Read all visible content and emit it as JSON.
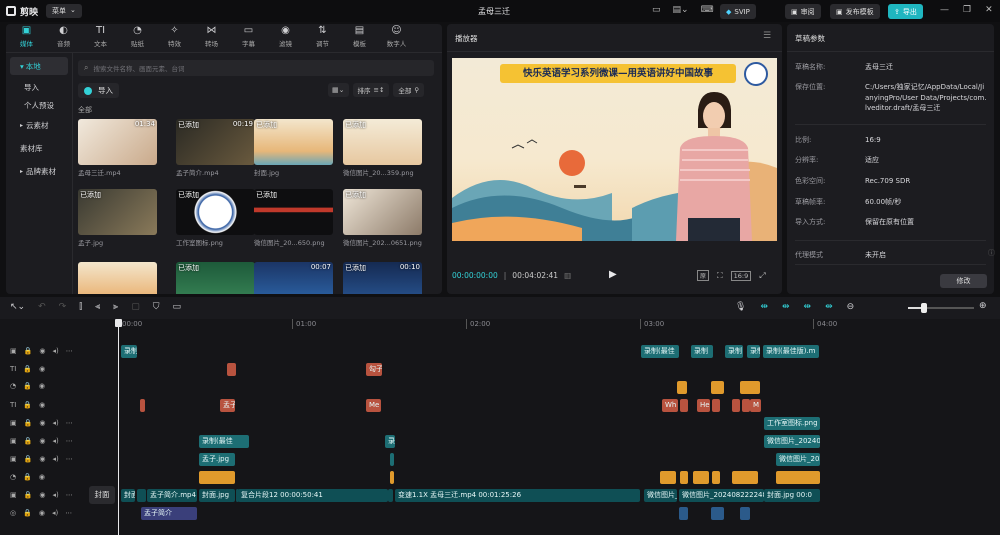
{
  "titlebar": {
    "app_name": "剪映",
    "menu_label": "菜单",
    "project_title": "孟母三迁",
    "svip_label": "SVIP",
    "review_label": "审阅",
    "publish_template_label": "发布模板",
    "export_label": "导出"
  },
  "media_tabs": [
    {
      "label": "媒体",
      "icon": "▣"
    },
    {
      "label": "音频",
      "icon": "◐"
    },
    {
      "label": "文本",
      "icon": "TI"
    },
    {
      "label": "贴纸",
      "icon": "◔"
    },
    {
      "label": "特效",
      "icon": "✧"
    },
    {
      "label": "转场",
      "icon": "⋈"
    },
    {
      "label": "字幕",
      "icon": "▭"
    },
    {
      "label": "滤镜",
      "icon": "◉"
    },
    {
      "label": "调节",
      "icon": "⇅"
    },
    {
      "label": "模板",
      "icon": "▤"
    },
    {
      "label": "数字人",
      "icon": "☺"
    }
  ],
  "sidebar": {
    "local": "本地",
    "import": "导入",
    "personal_preset": "个人预设",
    "cloud": "云素材",
    "library": "素材库",
    "brand": "品牌素材"
  },
  "media": {
    "search_placeholder": "搜索文件名称、画面元素、台词",
    "import_label": "导入",
    "sort_label": "排序",
    "all_label": "全部",
    "section_label": "全部",
    "items": [
      {
        "label": "孟母三迁.mp4",
        "badge": "",
        "duration": "01:34"
      },
      {
        "label": "孟子简介.mp4",
        "badge": "已添加",
        "duration": "00:19"
      },
      {
        "label": "封面.jpg",
        "badge": "已添加",
        "duration": ""
      },
      {
        "label": "微信图片_20...359.png",
        "badge": "已添加",
        "duration": ""
      },
      {
        "label": "孟子.jpg",
        "badge": "已添加",
        "duration": ""
      },
      {
        "label": "工作室图标.png",
        "badge": "已添加",
        "duration": ""
      },
      {
        "label": "微信图片_20...650.png",
        "badge": "已添加",
        "duration": ""
      },
      {
        "label": "微信图片_202...0651.png",
        "badge": "已添加",
        "duration": ""
      },
      {
        "label": "",
        "badge": "",
        "duration": ""
      },
      {
        "label": "",
        "badge": "已添加",
        "duration": ""
      },
      {
        "label": "",
        "badge": "",
        "duration": "00:07"
      },
      {
        "label": "",
        "badge": "已添加",
        "duration": "00:10"
      }
    ]
  },
  "player": {
    "title": "播放器",
    "banner": "快乐英语学习系列微课—用英语讲好中国故事",
    "current_time": "00:00:00:00",
    "total_time": "00:04:02:41",
    "ratio_label": "16:9"
  },
  "draft": {
    "title": "草稿参数",
    "rows": [
      {
        "key": "草稿名称:",
        "value": "孟母三迁"
      },
      {
        "key": "保存位置:",
        "value": "C:/Users/独家记忆/AppData/Local/JianyingPro/User Data/Projects/com.lveditor.draft/孟母三迁"
      },
      {
        "key": "比例:",
        "value": "16:9"
      },
      {
        "key": "分辨率:",
        "value": "适应"
      },
      {
        "key": "色彩空间:",
        "value": "Rec.709 SDR"
      },
      {
        "key": "草稿帧率:",
        "value": "60.00帧/秒"
      },
      {
        "key": "导入方式:",
        "value": "保留在原有位置"
      },
      {
        "key": "代理模式",
        "value": "未开启"
      }
    ],
    "modify_label": "修改"
  },
  "timeline": {
    "cover_label": "封面",
    "ticks": [
      "00:00",
      "01:00",
      "02:00",
      "03:00",
      "04:00"
    ],
    "clips": {
      "t1a": "录制(最",
      "t1b": "录制(最佳",
      "t1c": "录制",
      "t1d": "录制",
      "t1e": "录制",
      "t1f": "录制(最佳版).m",
      "t3a": "勾子",
      "t5a": "孟子",
      "t5b": "Me",
      "t5c": "Wh",
      "t5d": "He",
      "t5e": "M",
      "t6a": "工作室图标.png",
      "t7a": "录制(最佳",
      "t7b": "录",
      "t7c": "微信图片_202408",
      "t8a": "孟子.jpg",
      "t8b": "微信图片_202",
      "main1": "封面",
      "main2": "孟子简介.mp4",
      "main3": "封面.jpg",
      "main4": "复合片段12  00:00:50:41",
      "main5": "变速1.1X  孟母三迁.mp4  00:01:25:26",
      "main6": "微信图片_2024",
      "main7": "微信图片_20240822224841",
      "main8": "封面.jpg  00:0",
      "audio1": "孟子简介"
    }
  },
  "colors": {
    "accent": "#33d1d7",
    "export": "#1fb6c0",
    "clip_teal": "#1d6e74",
    "clip_orange": "#e09a2c",
    "clip_red": "#b8533f"
  }
}
